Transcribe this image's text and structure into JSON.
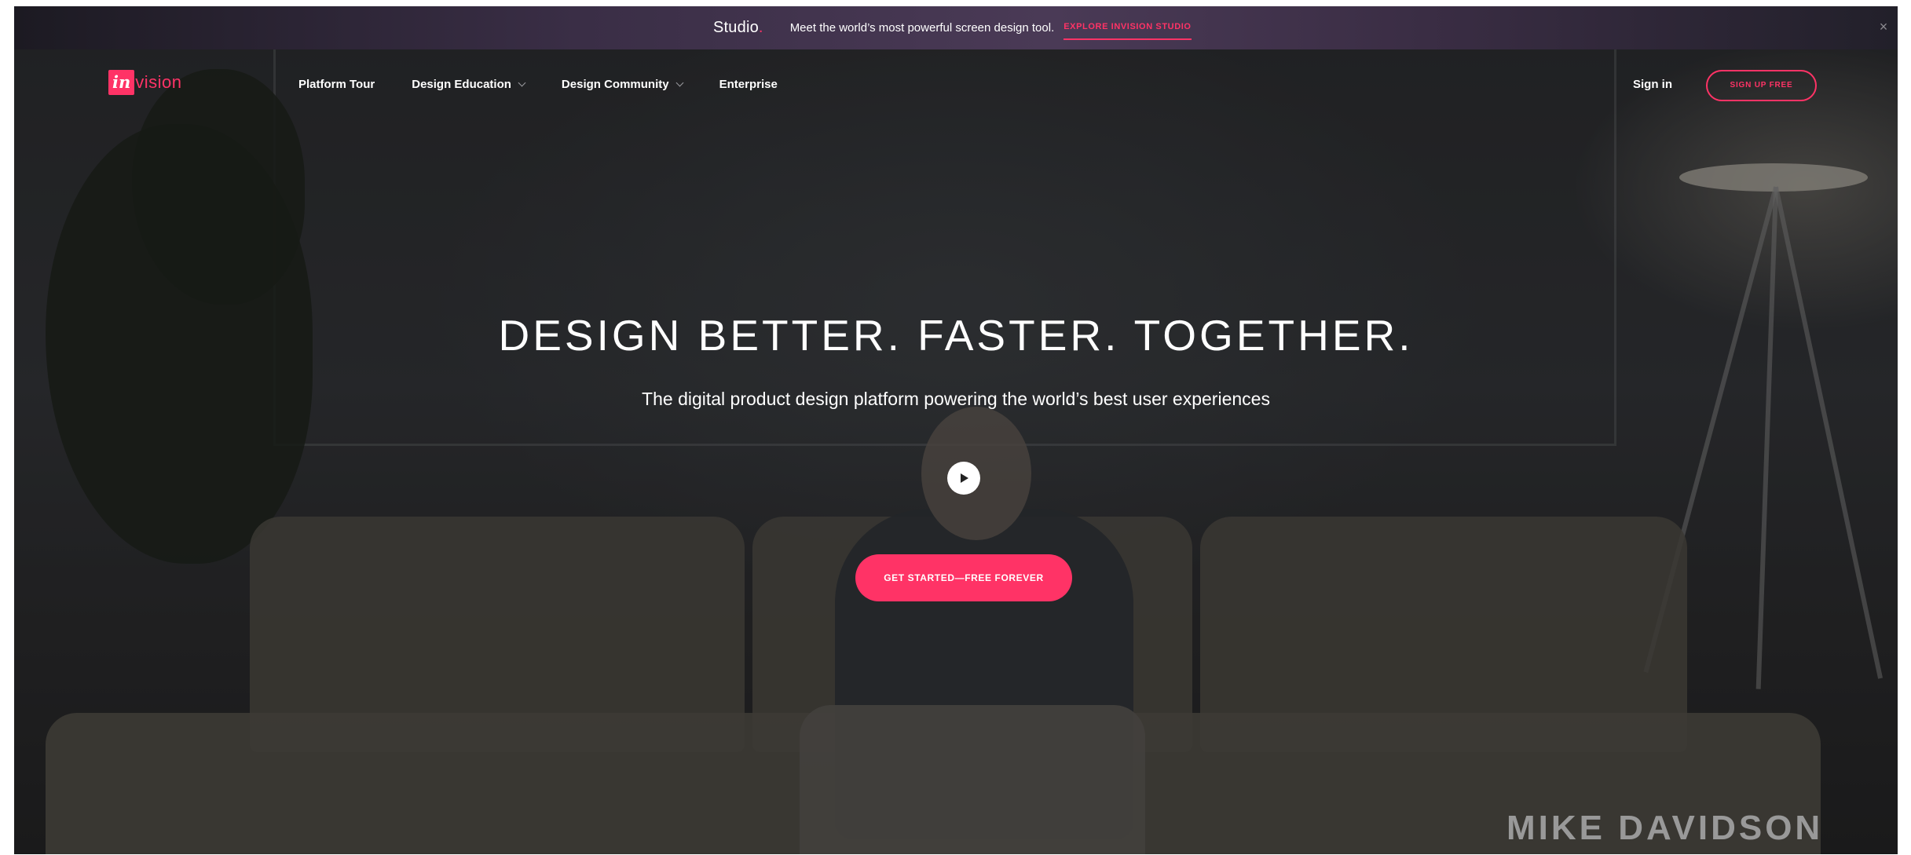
{
  "promo": {
    "studio_logo": "Studio",
    "studio_dot": ".",
    "message": "Meet the world’s most powerful screen design tool.",
    "link_label": "EXPLORE INVISION STUDIO",
    "close_glyph": "×"
  },
  "nav": {
    "logo_in": "in",
    "logo_word": "vision",
    "links": [
      {
        "label": "Platform Tour"
      },
      {
        "label": "Design Education"
      },
      {
        "label": "Design Community"
      },
      {
        "label": "Enterprise"
      }
    ],
    "sign_in": "Sign in",
    "signup_label": "SIGN UP FREE"
  },
  "hero": {
    "title": "DESIGN BETTER. FASTER. TOGETHER.",
    "subtitle": "The digital product design platform powering the world’s best user experiences",
    "cta_label": "GET STARTED—FREE FOREVER",
    "speaker_name": "MIKE DAVIDSON"
  },
  "colors": {
    "accent": "#ff3366",
    "text": "#ffffff"
  },
  "icons": {
    "play": "play-icon",
    "close": "close-icon",
    "chevron": "chevron-down-icon"
  }
}
